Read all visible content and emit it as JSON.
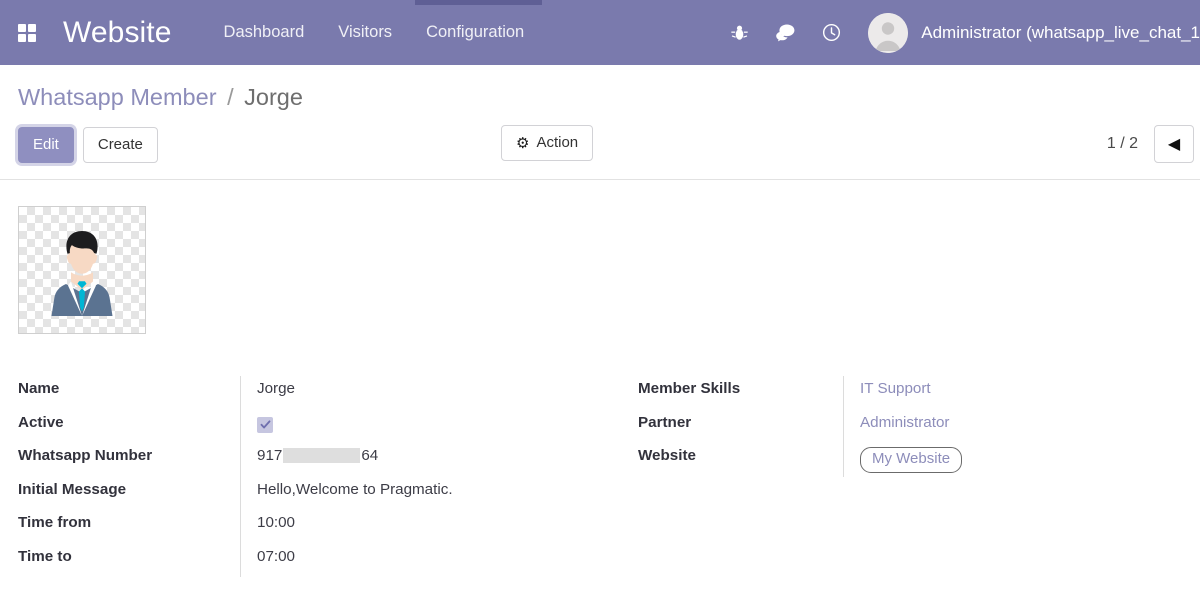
{
  "navbar": {
    "apps_icon": "apps-grid-icon",
    "brand": "Website",
    "menu": [
      {
        "label": "Dashboard"
      },
      {
        "label": "Visitors"
      },
      {
        "label": "Configuration"
      }
    ],
    "system_icons": [
      {
        "name": "bug-icon"
      },
      {
        "name": "messages-icon"
      },
      {
        "name": "activity-clock-icon"
      }
    ],
    "user": {
      "name": "Administrator (whatsapp_live_chat_1",
      "avatar": "user-avatar-icon"
    },
    "accent_color": "#7a7aad",
    "loading_bar_color": "#5f5f95"
  },
  "control_panel": {
    "breadcrumb": {
      "parent": "Whatsapp Member",
      "separator": "/",
      "current": "Jorge"
    },
    "edit_label": "Edit",
    "create_label": "Create",
    "action_label": "Action",
    "action_icon": "gear-icon",
    "pager": {
      "count": "1 / 2",
      "prev_icon": "◀"
    }
  },
  "form": {
    "avatar": "member-photo-placeholder",
    "left_fields": [
      {
        "label": "Name",
        "value": "Jorge",
        "type": "text"
      },
      {
        "label": "Active",
        "value": "",
        "type": "checkbox",
        "checked": true
      },
      {
        "label": "Whatsapp Number",
        "value": "917",
        "type": "redacted",
        "suffix": "64"
      },
      {
        "label": "Initial Message",
        "value": "Hello,Welcome to Pragmatic.",
        "type": "text"
      },
      {
        "label": "Time from",
        "value": "10:00",
        "type": "text"
      },
      {
        "label": "Time to",
        "value": "07:00",
        "type": "text"
      }
    ],
    "right_fields": [
      {
        "label": "Member Skills",
        "value": "IT Support",
        "type": "link"
      },
      {
        "label": "Partner",
        "value": "Administrator",
        "type": "link"
      },
      {
        "label": "Website",
        "value": "My Website",
        "type": "badge"
      }
    ]
  },
  "colors": {
    "brand_purple": "#7a7aad",
    "link_purple": "#8d8dba",
    "text_dark": "#32323c"
  }
}
